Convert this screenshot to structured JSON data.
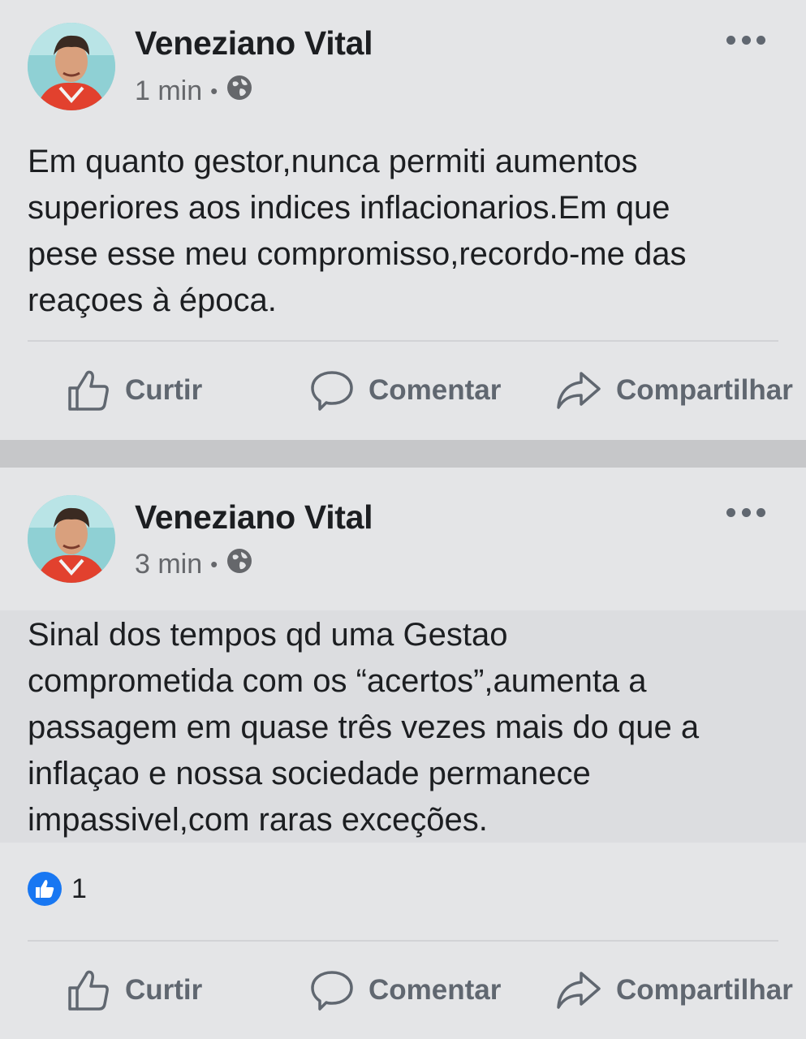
{
  "posts": [
    {
      "author": "Veneziano Vital",
      "time": "1 min",
      "separator": "•",
      "text": "Em quanto gestor,nunca permiti aumentos\nsuperiores aos indices inflacionarios.Em que\npese esse meu compromisso,recordo-me das\nreaçoes à época.",
      "actions": {
        "like": "Curtir",
        "comment": "Comentar",
        "share": "Compartilhar"
      }
    },
    {
      "author": "Veneziano Vital",
      "time": "3 min",
      "separator": "•",
      "text": "Sinal dos tempos qd uma Gestao\ncomprometida com os “acertos”,aumenta a\npassagem em quase três vezes mais do que a\ninflaçao e nossa sociedade permanece\nimpassivel,com raras exceções.",
      "reaction_count": "1",
      "actions": {
        "like": "Curtir",
        "comment": "Comentar",
        "share": "Compartilhar"
      }
    }
  ],
  "icons": {
    "more": "more-options-icon",
    "privacy": "globe-icon",
    "like": "thumbs-up-icon",
    "comment": "comment-icon",
    "share": "share-arrow-icon"
  },
  "colors": {
    "accent": "#1877f2",
    "secondary_text": "#606770"
  }
}
